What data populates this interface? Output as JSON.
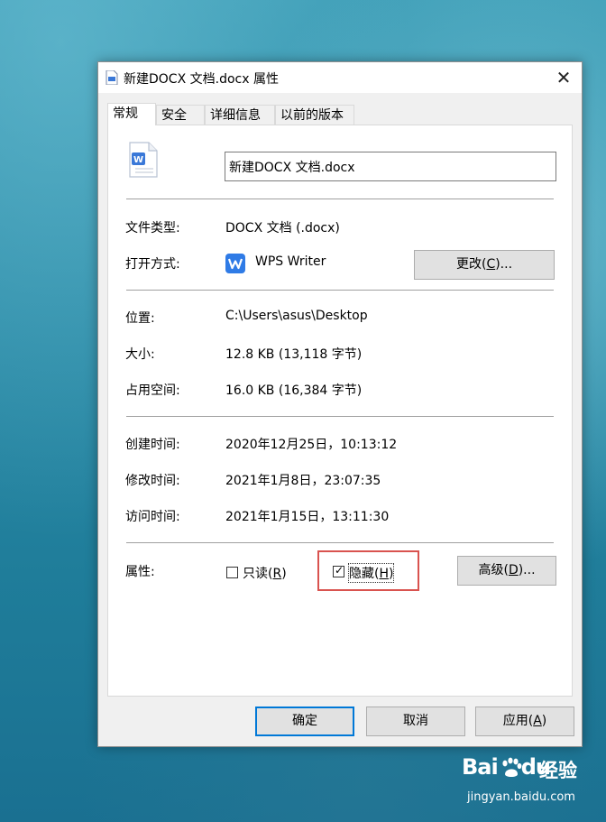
{
  "window": {
    "title": "新建DOCX 文档.docx 属性",
    "close_glyph": "✕"
  },
  "tabs": [
    {
      "label": "常规",
      "active": true
    },
    {
      "label": "安全",
      "active": false
    },
    {
      "label": "详细信息",
      "active": false
    },
    {
      "label": "以前的版本",
      "active": false
    }
  ],
  "general": {
    "filename": "新建DOCX 文档.docx",
    "file_type_label": "文件类型:",
    "file_type_value": "DOCX 文档 (.docx)",
    "opens_with_label": "打开方式:",
    "opens_with_value": "WPS Writer",
    "change_button": {
      "text": "更改(",
      "key": "C",
      "suffix": ")..."
    },
    "location_label": "位置:",
    "location_value": "C:\\Users\\asus\\Desktop",
    "size_label": "大小:",
    "size_value": "12.8 KB (13,118 字节)",
    "size_on_disk_label": "占用空间:",
    "size_on_disk_value": "16.0 KB (16,384 字节)",
    "created_label": "创建时间:",
    "created_value": "2020年12月25日，10:13:12",
    "modified_label": "修改时间:",
    "modified_value": "2021年1月8日，23:07:35",
    "accessed_label": "访问时间:",
    "accessed_value": "2021年1月15日，13:11:30",
    "attributes_label": "属性:",
    "readonly": {
      "text": "只读(",
      "key": "R",
      "suffix": ")",
      "checked": false
    },
    "hidden": {
      "text": "隐藏(",
      "key": "H",
      "suffix": ")",
      "checked": true
    },
    "advanced_button": {
      "text": "高级(",
      "key": "D",
      "suffix": ")..."
    }
  },
  "footer": {
    "ok": "确定",
    "cancel": "取消",
    "apply": {
      "text": "应用(",
      "key": "A",
      "suffix": ")"
    }
  },
  "watermark": {
    "brand_a": "Bai",
    "brand_b": "du",
    "brand_cn": "经验",
    "url": "jingyan.baidu.com"
  },
  "colors": {
    "accent": "#0078d7",
    "highlight_box": "#d9534f"
  }
}
